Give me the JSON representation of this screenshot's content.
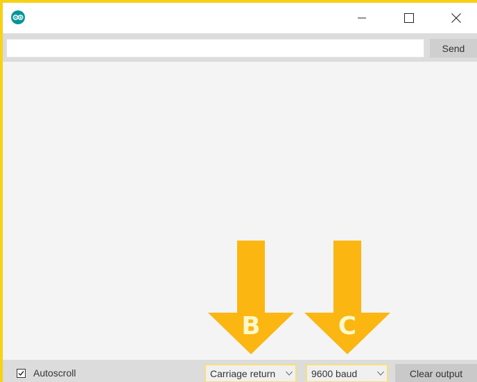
{
  "window": {
    "app_icon": "arduino-icon",
    "controls": [
      "minimize-icon",
      "maximize-icon",
      "close-icon"
    ]
  },
  "send_row": {
    "input_value": "",
    "input_placeholder": "",
    "send_label": "Send"
  },
  "annotations": {
    "arrow_b_label": "B",
    "arrow_c_label": "C",
    "arrow_color": "#fbb611"
  },
  "bottom_bar": {
    "autoscroll_label": "Autoscroll",
    "autoscroll_checked": true,
    "line_ending_selected": "Carriage return",
    "baud_selected": "9600 baud",
    "clear_label": "Clear output"
  },
  "colors": {
    "highlight_border": "#f7d117",
    "app_icon": "#00979c"
  }
}
